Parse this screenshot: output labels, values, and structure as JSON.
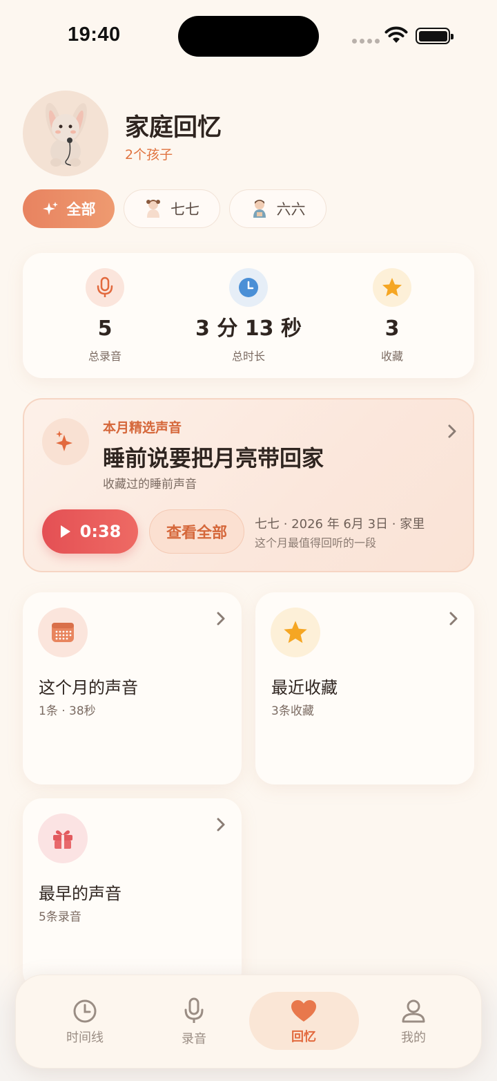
{
  "status": {
    "time": "19:40"
  },
  "header": {
    "title": "家庭回忆",
    "subtitle": "2个孩子"
  },
  "filters": [
    {
      "label": "全部",
      "active": true
    },
    {
      "label": "七七",
      "active": false
    },
    {
      "label": "六六",
      "active": false
    }
  ],
  "stats": [
    {
      "value": "5",
      "label": "总录音",
      "icon": "mic-icon"
    },
    {
      "value": "3 分 13 秒",
      "label": "总时长",
      "icon": "clock-icon"
    },
    {
      "value": "3",
      "label": "收藏",
      "icon": "star-icon"
    }
  ],
  "featured": {
    "label": "本月精选声音",
    "title": "睡前说要把月亮带回家",
    "subtitle": "收藏过的睡前声音",
    "play_label": "0:38",
    "view_all_label": "查看全部",
    "meta": "七七 · 2026 年 6月 3日 · 家里",
    "meta2": "这个月最值得回听的一段"
  },
  "cards": [
    {
      "title": "这个月的声音",
      "subtitle": "1条 · 38秒",
      "icon": "calendar-icon"
    },
    {
      "title": "最近收藏",
      "subtitle": "3条收藏",
      "icon": "star-icon"
    },
    {
      "title": "最早的声音",
      "subtitle": "5条录音",
      "icon": "gift-icon"
    }
  ],
  "tabs": [
    {
      "label": "时间线",
      "icon": "clock-icon",
      "active": false
    },
    {
      "label": "录音",
      "icon": "mic-icon",
      "active": false
    },
    {
      "label": "回忆",
      "icon": "heart-icon",
      "active": true
    },
    {
      "label": "我的",
      "icon": "person-icon",
      "active": false
    }
  ],
  "colors": {
    "accent": "#e2693d",
    "play": "#e45054",
    "background": "#fdf7f0"
  }
}
